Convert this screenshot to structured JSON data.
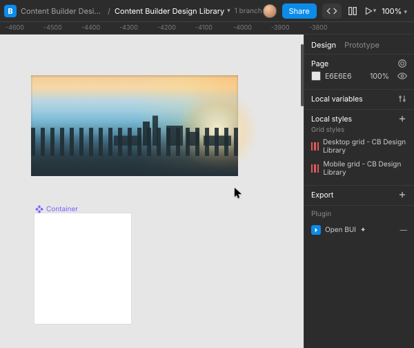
{
  "topbar": {
    "logo_letter": "B",
    "breadcrumb_parent": "Content Builder Design Li...",
    "breadcrumb_current": "Content Builder Design Library",
    "branch_label": "1 branch",
    "share_label": "Share",
    "zoom_label": "100%"
  },
  "ruler_ticks": [
    "-4600",
    "-4500",
    "-4400",
    "-4300",
    "-4200",
    "-4100",
    "-4000",
    "-3900",
    "-3800"
  ],
  "canvas": {
    "component_label": "Container"
  },
  "panel": {
    "tabs": {
      "design": "Design",
      "prototype": "Prototype"
    },
    "page_section": {
      "title": "Page",
      "bg_value": "E6E6E6",
      "opacity": "100%"
    },
    "local_vars_title": "Local variables",
    "local_styles": {
      "title": "Local styles",
      "grid_group": "Grid styles",
      "items": [
        "Desktop grid - CB Design Library",
        "Mobile grid - CB Design Library"
      ]
    },
    "export_title": "Export",
    "plugin_title": "Plugin",
    "plugin_name": "Open BUI"
  }
}
